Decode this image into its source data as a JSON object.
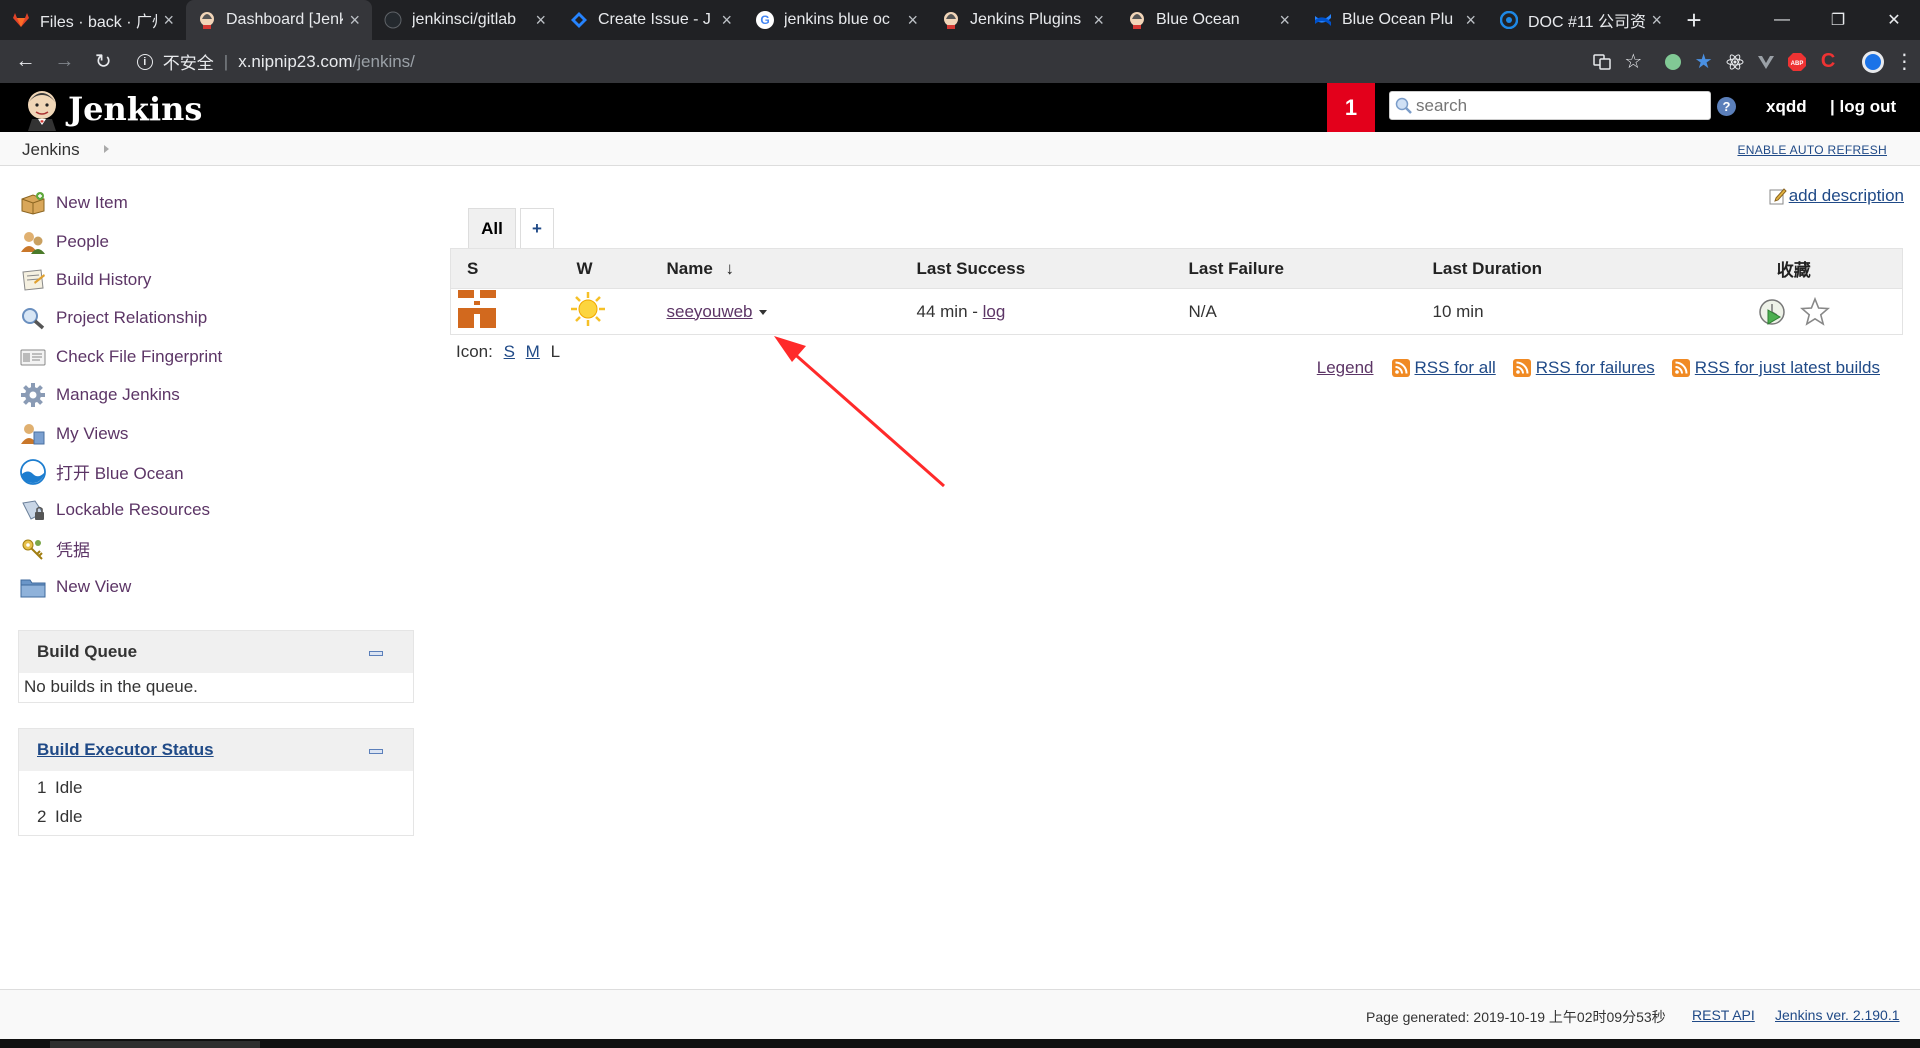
{
  "browser": {
    "tabs": [
      {
        "title": "Files · back · 广州",
        "favicon": "gitlab-icon",
        "color": "#e24329"
      },
      {
        "title": "Dashboard [Jenkins]",
        "favicon": "jenkins-icon",
        "color": "#d33833"
      },
      {
        "title": "jenkinsci/gitlab",
        "favicon": "github-icon",
        "color": "#24292e"
      },
      {
        "title": "Create Issue - J",
        "favicon": "jira-icon",
        "color": "#2684ff"
      },
      {
        "title": "jenkins blue oc",
        "favicon": "google-icon",
        "color": "#4285f4"
      },
      {
        "title": "Jenkins Plugins",
        "favicon": "jenkins-icon",
        "color": "#d33833"
      },
      {
        "title": "Blue Ocean",
        "favicon": "jenkins-icon",
        "color": "#d33833"
      },
      {
        "title": "Blue Ocean Plu",
        "favicon": "confluence-icon",
        "color": "#2684ff"
      },
      {
        "title": "DOC #11 公司资",
        "favicon": "doc-icon",
        "color": "#1e88e5"
      }
    ],
    "security_label": "不安全",
    "url_host": "x.nipnip23.com",
    "url_path": "/jenkins/"
  },
  "header": {
    "title": "Jenkins",
    "notification_count": "1",
    "search_placeholder": "search",
    "username": "xqdd",
    "logout": "| log out"
  },
  "breadcrumb": {
    "root": "Jenkins",
    "auto_refresh": "ENABLE AUTO REFRESH"
  },
  "sidebar": {
    "tasks": [
      {
        "label": "New Item",
        "icon": "new-item-icon"
      },
      {
        "label": "People",
        "icon": "people-icon"
      },
      {
        "label": "Build History",
        "icon": "build-history-icon"
      },
      {
        "label": "Project Relationship",
        "icon": "search-icon"
      },
      {
        "label": "Check File Fingerprint",
        "icon": "fingerprint-icon"
      },
      {
        "label": "Manage Jenkins",
        "icon": "gear-icon"
      },
      {
        "label": "My Views",
        "icon": "my-views-icon"
      },
      {
        "label": "打开 Blue Ocean",
        "icon": "blue-ocean-icon"
      },
      {
        "label": "Lockable Resources",
        "icon": "lock-resources-icon"
      },
      {
        "label": "凭据",
        "icon": "credentials-icon"
      },
      {
        "label": "New View",
        "icon": "folder-icon"
      }
    ],
    "build_queue": {
      "title": "Build Queue",
      "empty": "No builds in the queue."
    },
    "executors": {
      "title": "Build Executor Status",
      "rows": [
        {
          "num": "1",
          "status": "Idle"
        },
        {
          "num": "2",
          "status": "Idle"
        }
      ]
    }
  },
  "main": {
    "add_description": "add description",
    "view_tabs": {
      "active": "All",
      "add": "+"
    },
    "table": {
      "headers": {
        "status": "S",
        "weather": "W",
        "name": "Name",
        "sort_arrow": "↓",
        "last_success": "Last Success",
        "last_failure": "Last Failure",
        "last_duration": "Last Duration",
        "favorite": "收藏"
      },
      "rows": [
        {
          "name": "seeyouweb",
          "last_success": "44 min - ",
          "last_success_link": "log",
          "last_failure": "N/A",
          "last_duration": "10 min"
        }
      ]
    },
    "icon_size": {
      "label": "Icon:",
      "s": "S",
      "m": "M",
      "l": "L"
    },
    "legend": "Legend",
    "rss": {
      "all": "RSS for all",
      "failures": "RSS for failures",
      "latest": "RSS for just latest builds"
    }
  },
  "footer": {
    "generated": "Page generated: 2019-10-19 上午02时09分53秒",
    "rest_api": "REST API",
    "version": "Jenkins ver. 2.190.1"
  },
  "colors": {
    "header_bg": "#000000",
    "badge": "#e3001b",
    "link": "#204a87",
    "visited_link": "#5c3566",
    "build_status": "#d2691e",
    "annotation_arrow": "#ff2a2a"
  }
}
